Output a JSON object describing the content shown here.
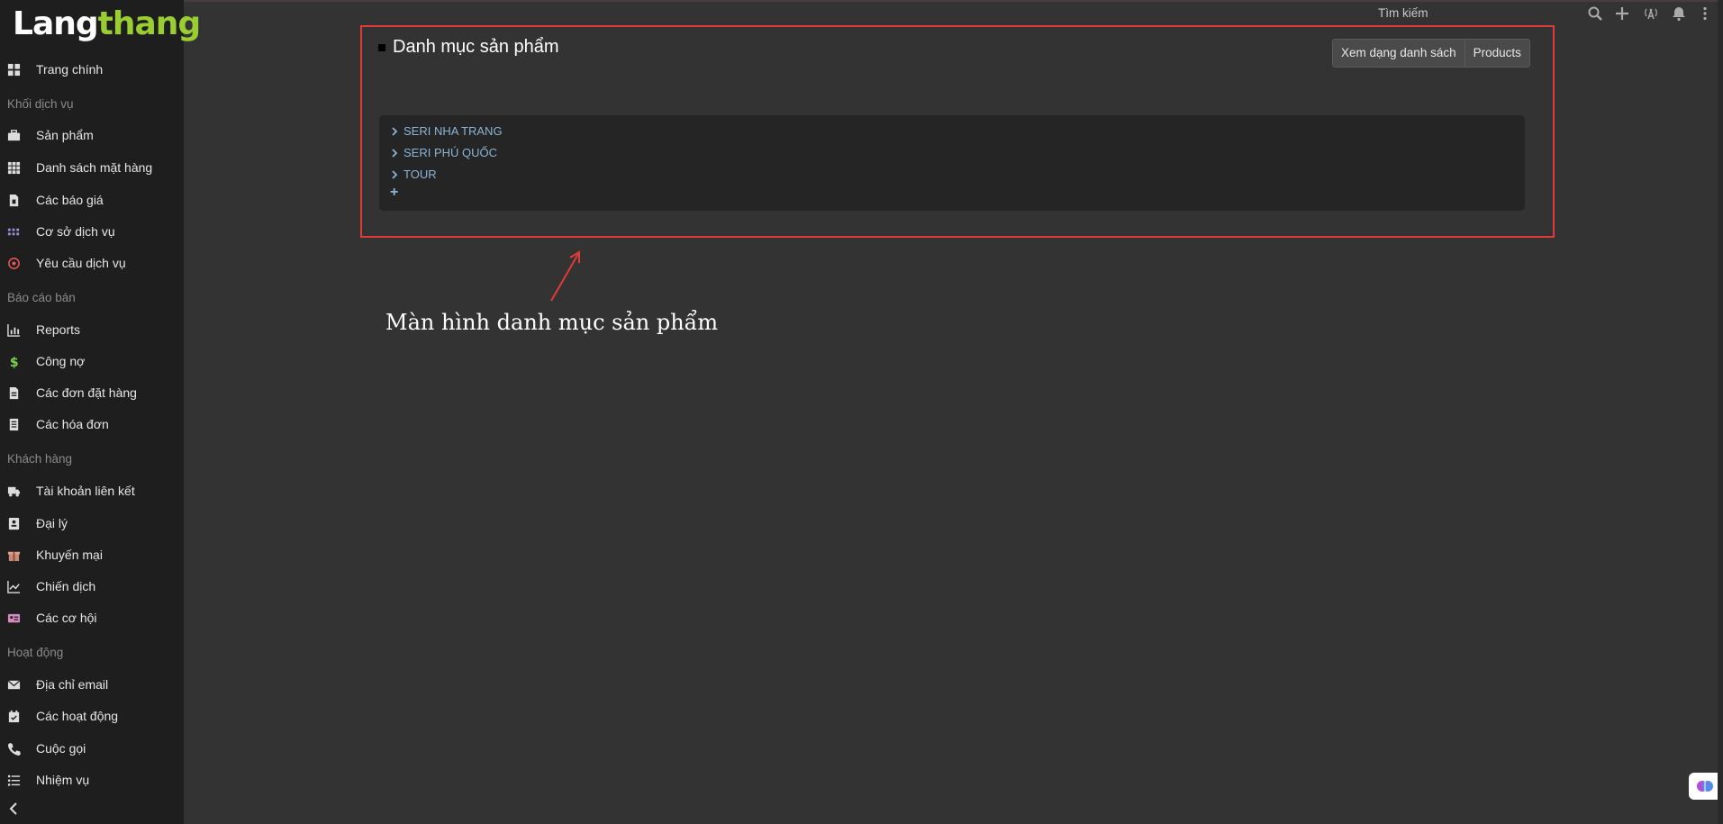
{
  "logo": {
    "part1": "Lang",
    "part2": "thang"
  },
  "sidebar": {
    "items": [
      {
        "label": "Trang chính",
        "icon": "grid-icon"
      },
      {
        "section": "Khối dịch vụ"
      },
      {
        "label": "Sản phẩm",
        "icon": "briefcase-icon"
      },
      {
        "label": "Danh sách mặt hàng",
        "icon": "grid-list-icon"
      },
      {
        "label": "Các báo giá",
        "icon": "document-icon"
      },
      {
        "label": "Cơ sở dịch vụ",
        "icon": "dots-grid-icon"
      },
      {
        "label": "Yêu cầu dịch vụ",
        "icon": "target-icon"
      },
      {
        "section": "Báo cáo bán"
      },
      {
        "label": "Reports",
        "icon": "bar-chart-icon"
      },
      {
        "label": "Công nợ",
        "icon": "dollar-icon"
      },
      {
        "label": "Các đơn đặt hàng",
        "icon": "order-doc-icon"
      },
      {
        "label": "Các hóa đơn",
        "icon": "invoice-icon"
      },
      {
        "section": "Khách hàng"
      },
      {
        "label": "Tài khoản liên kết",
        "icon": "truck-icon"
      },
      {
        "label": "Đại lý",
        "icon": "agent-card-icon"
      },
      {
        "label": "Khuyến mại",
        "icon": "gift-icon"
      },
      {
        "label": "Chiến dịch",
        "icon": "line-chart-icon"
      },
      {
        "label": "Các cơ hội",
        "icon": "id-card-icon"
      },
      {
        "section": "Hoạt động"
      },
      {
        "label": "Địa chỉ email",
        "icon": "envelope-icon"
      },
      {
        "label": "Các hoạt động",
        "icon": "calendar-check-icon"
      },
      {
        "label": "Cuộc gọi",
        "icon": "phone-icon"
      },
      {
        "label": "Nhiệm vụ",
        "icon": "task-list-icon"
      }
    ]
  },
  "topbar": {
    "search_label": "Tìm kiếm"
  },
  "main": {
    "title": "Danh mục sản phẩm",
    "buttons": {
      "list_view": "Xem dạng danh sách",
      "products": "Products"
    },
    "tree": [
      "SERI NHA TRANG",
      "SERI PHÚ QUỐC",
      "TOUR"
    ],
    "add_symbol": "+"
  },
  "annotation": "Màn hình danh mục sản phẩm",
  "colors": {
    "accent": "#9acd32",
    "highlight_border": "#e03a3a",
    "tree_link": "#8ab4d8"
  }
}
